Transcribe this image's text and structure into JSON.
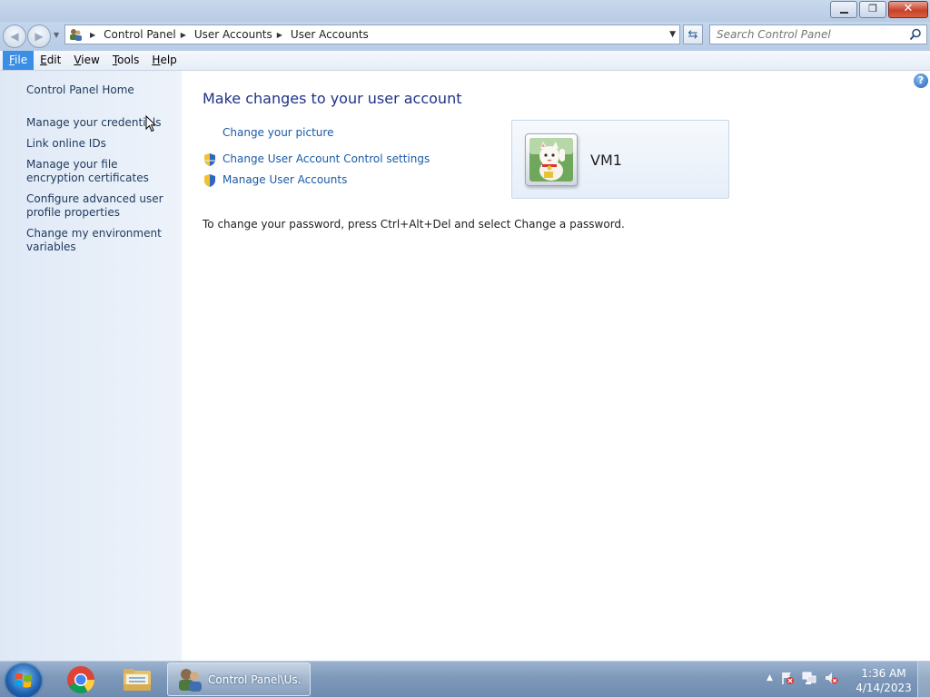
{
  "window": {
    "caption": {
      "minimize": "—",
      "restore": "❐",
      "close": "✕"
    }
  },
  "navigation": {
    "back_icon": "back-arrow-icon",
    "forward_icon": "forward-arrow-icon",
    "breadcrumbs": [
      "Control Panel",
      "User Accounts",
      "User Accounts"
    ],
    "search_placeholder": "Search Control Panel"
  },
  "menu": {
    "items": [
      {
        "underline": "F",
        "rest": "ile"
      },
      {
        "underline": "E",
        "rest": "dit"
      },
      {
        "underline": "V",
        "rest": "iew"
      },
      {
        "underline": "T",
        "rest": "ools"
      },
      {
        "underline": "H",
        "rest": "elp"
      }
    ]
  },
  "sidebar": {
    "home": "Control Panel Home",
    "links": [
      "Manage your credentials",
      "Link online IDs",
      "Manage your file encryption certificates",
      "Configure advanced user profile properties",
      "Change my environment variables"
    ]
  },
  "main": {
    "heading": "Make changes to your user account",
    "tasks": [
      {
        "label": "Change your picture",
        "shield": false
      },
      {
        "label": "Change User Account Control settings",
        "shield": true
      },
      {
        "label": "Manage User Accounts",
        "shield": true
      }
    ],
    "user": {
      "name": "VM1"
    },
    "password_note": "To change your password, press Ctrl+Alt+Del and select Change a password."
  },
  "taskbar": {
    "active_task_label": "Control Panel\\Us...",
    "clock_time": "1:36 AM",
    "clock_date": "4/14/2023"
  },
  "colors": {
    "link": "#1a5aa6",
    "heading": "#1e3287",
    "sidebar_link": "#1e395b",
    "menu_active": "#3a8ee6"
  }
}
